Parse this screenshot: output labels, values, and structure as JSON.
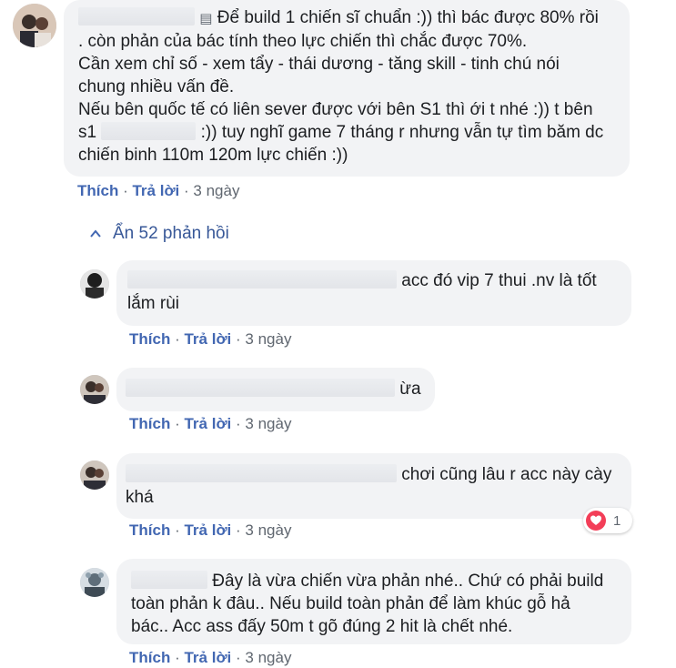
{
  "main_comment": {
    "emoji_icon": "speech-balloon-icon",
    "line1": "Để build 1 chiến sĩ chuẩn :)) thì bác được 80% rồi",
    "line2": ". còn phản của bác tính theo lực chiến thì chắc được 70%.",
    "line3": "Cần xem chỉ số - xem tẩy - thái dương - tăng skill - tinh chú nói",
    "line4": "chung nhiều vấn đề.",
    "line5": "Nếu bên quốc tế có liên sever được với bên S1 thì ới t nhé :)) t bên",
    "line6_prefix": "s1",
    "line6_suffix": ":)) tuy nghĩ game 7 tháng r nhưng vẫn tự tìm băm dc",
    "line7": "chiến binh 110m 120m lực chiến :))",
    "like": "Thích",
    "reply": "Trả lời",
    "time": "3 ngày"
  },
  "toggle": {
    "label": "Ẩn 52 phản hồi"
  },
  "replies": [
    {
      "line1": "acc đó vip 7 thui .nv là tốt",
      "line2": "lắm rùi",
      "like": "Thích",
      "reply": "Trả lời",
      "time": "3 ngày"
    },
    {
      "line1": "ừa",
      "like": "Thích",
      "reply": "Trả lời",
      "time": "3 ngày"
    },
    {
      "line1": "chơi cũng lâu r acc này cày",
      "line2": "khá",
      "like": "Thích",
      "reply": "Trả lời",
      "time": "3 ngày",
      "reaction": {
        "icon": "heart-icon",
        "count": "1",
        "color": "#f33e58"
      }
    },
    {
      "line1": "Đây là vừa chiến vừa phản nhé.. Chứ có phải build",
      "line2": "toàn phản k đâu.. Nếu build toàn phản để làm khúc gỗ hả",
      "line3": "bác.. Acc ass đấy 50m t gõ đúng 2 hit là chết nhé.",
      "like": "Thích",
      "reply": "Trả lời",
      "time": "3 ngày"
    }
  ],
  "separator": "·",
  "colors": {
    "bubble": "#f2f3f5",
    "link": "#4267b2",
    "muted": "#606770",
    "toggle": "#385898"
  }
}
